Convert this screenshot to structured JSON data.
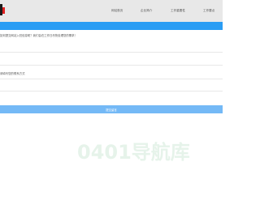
{
  "nav": {
    "items": [
      {
        "label": "网站首页"
      },
      {
        "label": "企业简介"
      },
      {
        "label": "工作重要性"
      },
      {
        "label": "工作要点"
      }
    ]
  },
  "message": {
    "notice": "如何提交网站入驻信息呢？我们会在工作日尽快处理您的需求！",
    "field_label": "请填写您的联系方式",
    "submit_label": "提交留言"
  },
  "watermark": {
    "text": "0401导航库"
  },
  "colors": {
    "nav_bg": "#e8e8e8",
    "blue_bar": "#2a9df4",
    "submit_bg": "#74b9f6",
    "watermark": "#e6f3ea"
  }
}
